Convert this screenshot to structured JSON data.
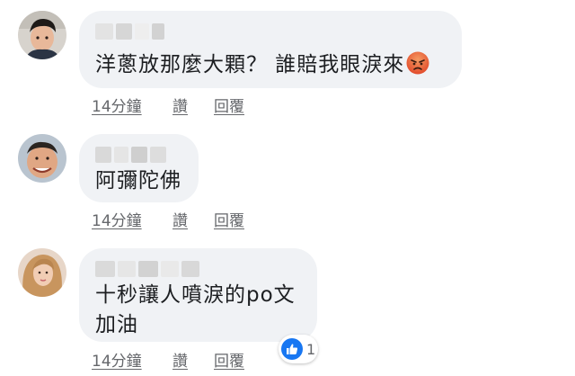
{
  "comments": [
    {
      "text": "洋蔥放那麼大顆？ 誰賠我眼淚來",
      "emoji": "angry-face-emoji",
      "actions": {
        "time": "14分鐘",
        "like": "讚",
        "reply": "回覆"
      }
    },
    {
      "text": "阿彌陀佛",
      "actions": {
        "time": "14分鐘",
        "like": "讚",
        "reply": "回覆"
      }
    },
    {
      "text": "十秒讓人噴淚的po文\n加油",
      "actions": {
        "time": "14分鐘",
        "like": "讚",
        "reply": "回覆"
      },
      "reaction": {
        "icon": "like-icon",
        "count": "1"
      }
    }
  ],
  "colors": {
    "bubble": "#f0f2f5",
    "meta_text": "#65676b",
    "like_blue": "#1877f2"
  }
}
